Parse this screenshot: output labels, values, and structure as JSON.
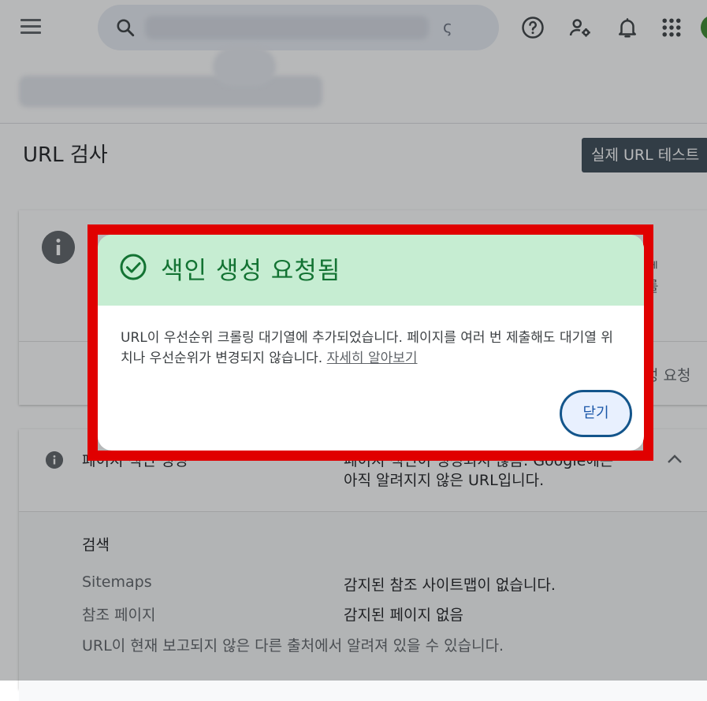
{
  "header": {
    "search_trailing": "ς"
  },
  "page": {
    "title": "URL 검사",
    "live_test_button": "실제 URL 테스트"
  },
  "card1": {
    "frag_right_top": "ᅦ",
    "frag_right_mid": "를",
    "frag_action": "성 요청"
  },
  "card2": {
    "label": "페이지 색인 생성",
    "status_line1": "페이지 색인이 생성되지 않음: Google에는",
    "status_line2": "아직 알려지지 않은 URL입니다.",
    "section_title": "검색",
    "rows": [
      {
        "label": "Sitemaps",
        "value": "감지된 참조 사이트맵이 없습니다."
      },
      {
        "label": "참조 페이지",
        "value": "감지된 페이지 없음"
      }
    ],
    "footnote": "URL이 현재 보고되지 않은 다른 출처에서 알려져 있을 수 있습니다."
  },
  "dialog": {
    "title": "색인 생성 요청됨",
    "body": "URL이 우선순위 크롤링 대기열에 추가되었습니다. 페이지를 여러 번 제출해도 대기열 위치나 우선순위가 변경되지 않습니다.",
    "learn_more": "자세히 알아보기",
    "close_button": "닫기"
  },
  "colors": {
    "dialog_header_bg": "#c6edd2",
    "dialog_title": "#137333",
    "highlight_frame": "#e00000",
    "close_button_border": "#13558b"
  },
  "icons": [
    "menu-icon",
    "search-icon",
    "help-icon",
    "admin-icon",
    "bell-icon",
    "apps-icon",
    "info-icon",
    "check-circle-icon",
    "chevron-up-icon"
  ]
}
